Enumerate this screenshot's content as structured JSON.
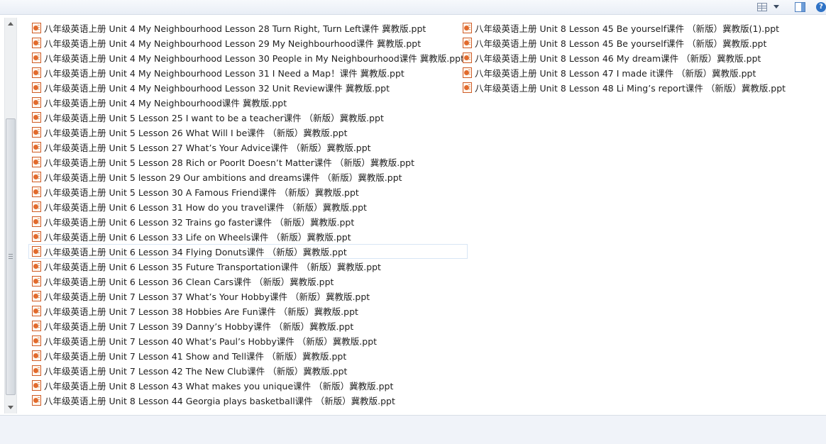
{
  "toolbar": {
    "view_icon": "view-options-icon",
    "pane_icon": "preview-pane-icon",
    "help_icon": "help-icon",
    "help_glyph": "?"
  },
  "files": {
    "column_1": [
      "八年级英语上册 Unit 4 My Neighbourhood Lesson 28 Turn Right, Turn Left课件 冀教版.ppt",
      "八年级英语上册 Unit 4 My Neighbourhood Lesson 29 My Neighbourhood课件 冀教版.ppt",
      "八年级英语上册 Unit 4 My Neighbourhood Lesson 30 People in My Neighbourhood课件 冀教版.ppt",
      "八年级英语上册 Unit 4 My Neighbourhood Lesson 31 I Need a Map！课件 冀教版.ppt",
      "八年级英语上册 Unit 4 My Neighbourhood Lesson 32 Unit Review课件 冀教版.ppt",
      "八年级英语上册 Unit 4 My Neighbourhood课件 冀教版.ppt",
      "八年级英语上册 Unit 5 Lesson 25 I want to be a teacher课件 （新版）冀教版.ppt",
      "八年级英语上册 Unit 5 Lesson 26 What Will I be课件 （新版）冀教版.ppt",
      "八年级英语上册 Unit 5 Lesson 27 What’s Your Advice课件 （新版）冀教版.ppt",
      "八年级英语上册 Unit 5 Lesson 28 Rich or PoorIt Doesn’t Matter课件 （新版）冀教版.ppt",
      "八年级英语上册 Unit 5 lesson 29 Our ambitions and dreams课件 （新版）冀教版.ppt",
      "八年级英语上册 Unit 5 Lesson 30 A Famous Friend课件 （新版）冀教版.ppt",
      "八年级英语上册 Unit 6 Lesson 31 How do you travel课件 （新版）冀教版.ppt",
      "八年级英语上册 Unit 6 Lesson 32 Trains go faster课件 （新版）冀教版.ppt",
      "八年级英语上册 Unit 6 Lesson 33 Life on Wheels课件 （新版）冀教版.ppt",
      "八年级英语上册 Unit 6 Lesson 34 Flying Donuts课件 （新版）冀教版.ppt",
      "八年级英语上册 Unit 6 Lesson 35 Future Transportation课件 （新版）冀教版.ppt",
      "八年级英语上册 Unit 6 Lesson 36 Clean Cars课件 （新版）冀教版.ppt",
      "八年级英语上册 Unit 7 Lesson 37 What’s Your Hobby课件 （新版）冀教版.ppt",
      "八年级英语上册 Unit 7 Lesson 38 Hobbies Are Fun课件 （新版）冀教版.ppt",
      "八年级英语上册 Unit 7 Lesson 39 Danny’s Hobby课件 （新版）冀教版.ppt",
      "八年级英语上册 Unit 7 Lesson 40 What’s Paul’s Hobby课件 （新版）冀教版.ppt",
      "八年级英语上册 Unit 7 Lesson 41 Show and Tell课件 （新版）冀教版.ppt",
      "八年级英语上册 Unit 7 Lesson 42 The New Club课件 （新版）冀教版.ppt",
      "八年级英语上册 Unit 8 Lesson 43 What makes you unique课件 （新版）冀教版.ppt",
      "八年级英语上册 Unit 8 Lesson 44 Georgia plays basketball课件 （新版）冀教版.ppt"
    ],
    "column_2": [
      "八年级英语上册 Unit 8 Lesson 45 Be yourself课件 （新版）冀教版(1).ppt",
      "八年级英语上册 Unit 8 Lesson 45 Be yourself课件 （新版）冀教版.ppt",
      "八年级英语上册 Unit 8 Lesson 46 My dream课件 （新版）冀教版.ppt",
      "八年级英语上册 Unit 8 Lesson 47 I made it课件 （新版）冀教版.ppt",
      "八年级英语上册 Unit 8 Lesson 48 Li Ming’s report课件 （新版）冀教版.ppt"
    ],
    "selected_index_column_1": 15,
    "file_icon": "powerpoint-file-icon"
  }
}
